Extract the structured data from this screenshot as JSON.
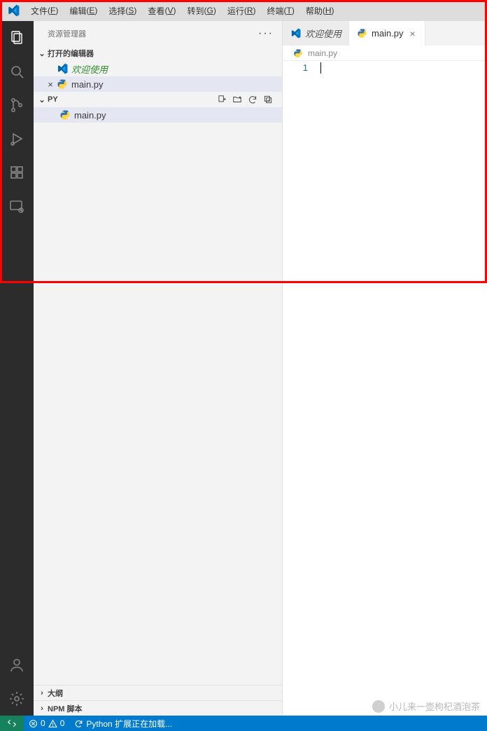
{
  "menu": {
    "items": [
      {
        "label": "文件",
        "key": "F"
      },
      {
        "label": "编辑",
        "key": "E"
      },
      {
        "label": "选择",
        "key": "S"
      },
      {
        "label": "查看",
        "key": "V"
      },
      {
        "label": "转到",
        "key": "G"
      },
      {
        "label": "运行",
        "key": "R"
      },
      {
        "label": "终端",
        "key": "T"
      },
      {
        "label": "帮助",
        "key": "H"
      }
    ]
  },
  "sidebar": {
    "title": "资源管理器",
    "open_editors_label": "打开的编辑器",
    "welcome_label": "欢迎使用",
    "mainpy_label": "main.py",
    "folder_label": "PY",
    "outline_label": "大纲",
    "npm_label": "NPM 脚本"
  },
  "tabs": {
    "welcome": "欢迎使用",
    "mainpy": "main.py"
  },
  "breadcrumb": {
    "file": "main.py"
  },
  "editor": {
    "line_number": "1"
  },
  "statusbar": {
    "errors": "0",
    "warnings": "0",
    "loading": "Python 扩展正在加载..."
  },
  "watermark": {
    "text": "小儿来一壶枸杞酒泡茶"
  },
  "icons": {
    "vscode": "vscode-logo-icon",
    "python": "python-file-icon"
  }
}
